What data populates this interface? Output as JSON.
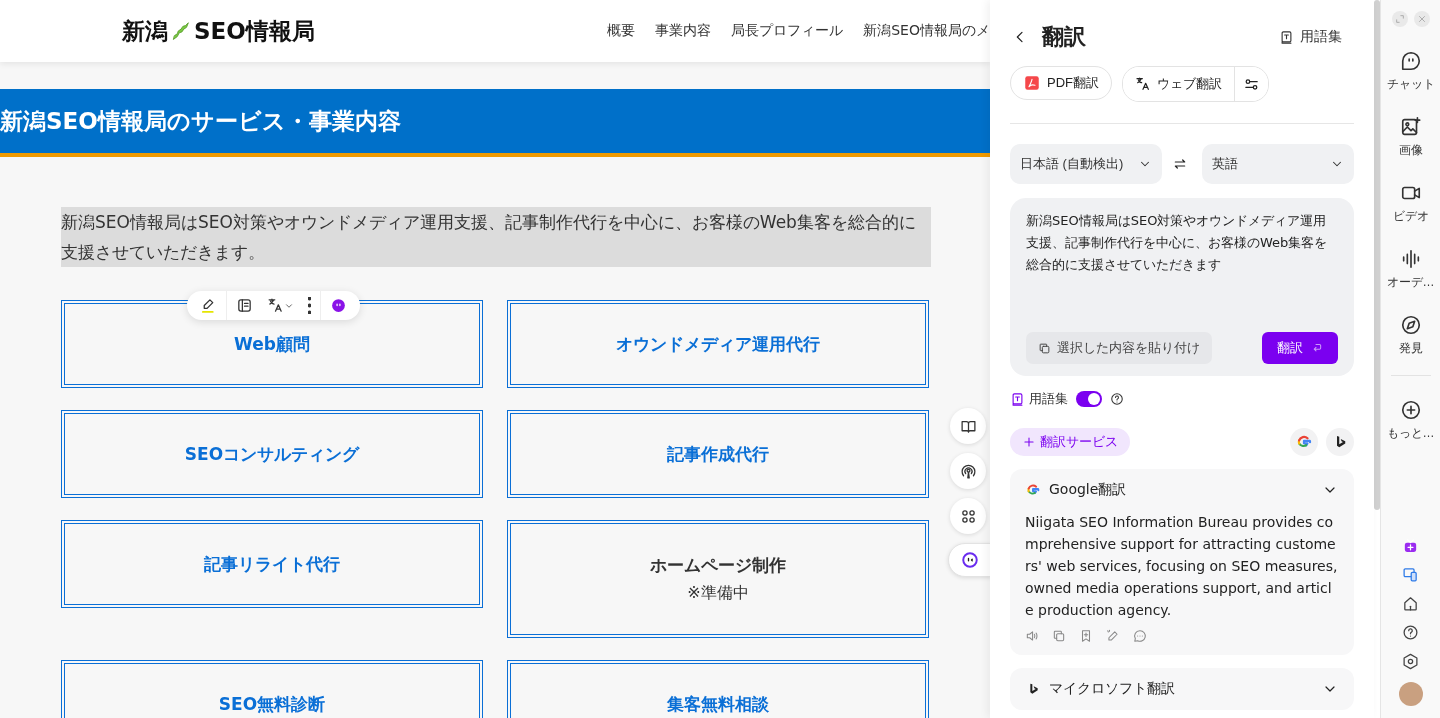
{
  "site": {
    "logo": {
      "before": "新潟",
      "after": "SEO情報局"
    },
    "nav": [
      "概要",
      "事業内容",
      "局長プロフィール",
      "新潟SEO情報局のメ"
    ],
    "heading": "新潟SEO情報局のサービス・事業内容",
    "intro": {
      "text": "新潟SEO情報局はSEO対策やオウンドメディア運用支援、記事制作代行を中心に、お客様のWeb集客を総合的に支援させていただきます。",
      "selected": true
    },
    "services": [
      {
        "title": "Web顧問",
        "link": true
      },
      {
        "title": "オウンドメディア運用代行",
        "link": true
      },
      {
        "title": "SEOコンサルティング",
        "link": true
      },
      {
        "title": "記事作成代行",
        "link": true
      },
      {
        "title": "記事リライト代行",
        "link": true
      },
      {
        "title": "ホームページ制作",
        "note": "※準備中",
        "link": false
      },
      {
        "title": "SEO無料診断",
        "link": true
      },
      {
        "title": "集客無料相談",
        "link": true
      }
    ]
  },
  "panel": {
    "title": "翻訳",
    "glossary_button": "用語集",
    "tools": [
      "PDF翻訳",
      "ウェブ翻訳"
    ],
    "source_language": "日本語 (自動検出)",
    "target_language": "英語",
    "source_text": "新潟SEO情報局はSEO対策やオウンドメディア運用支援、記事制作代行を中心に、お客様のWeb集客を総合的に支援させていただきます",
    "paste_button": "選択した内容を貼り付け",
    "translate_button": "翻訳",
    "glossary_toggle": {
      "label": "用語集",
      "on": true
    },
    "add_service": "翻訳サービス",
    "results": [
      {
        "kind": "google",
        "name": "Google翻訳",
        "text": "Niigata SEO Information Bureau provides comprehensive support for attracting customers' web services, focusing on SEO measures, owned media operations support, and article production agency."
      },
      {
        "kind": "microsoft",
        "name": "マイクロソフト翻訳"
      }
    ]
  },
  "rail": {
    "items": [
      {
        "kind": "chat",
        "label": "チャット"
      },
      {
        "kind": "image",
        "label": "画像"
      },
      {
        "kind": "video",
        "label": "ビデオ"
      },
      {
        "kind": "audio",
        "label": "オーデ…"
      },
      {
        "kind": "discover",
        "label": "発見"
      },
      {
        "kind": "more",
        "label": "もっと…"
      }
    ]
  }
}
